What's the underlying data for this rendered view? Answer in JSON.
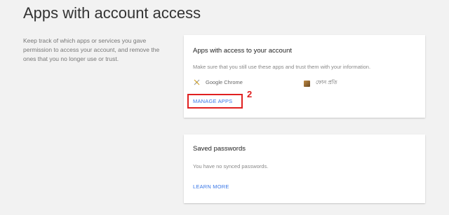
{
  "page": {
    "title": "Apps with account access",
    "description": "Keep track of which apps or services you gave permission to access your account, and remove the ones that you no longer use or trust."
  },
  "apps_card": {
    "title": "Apps with access to your account",
    "hint": "Make sure that you still use these apps and trust them with your information.",
    "apps": [
      {
        "name": "Google Chrome",
        "icon": "chrome-icon"
      },
      {
        "name": "ফোন প্রতি",
        "icon": "app-thumbnail-icon"
      }
    ],
    "action_label": "MANAGE APPS"
  },
  "annotation": {
    "step": "2",
    "color": "#e02020"
  },
  "passwords_card": {
    "title": "Saved passwords",
    "hint": "You have no synced passwords.",
    "action_label": "LEARN MORE"
  },
  "colors": {
    "link": "#3b78e7",
    "background": "#f2f2f2",
    "card": "#ffffff"
  }
}
